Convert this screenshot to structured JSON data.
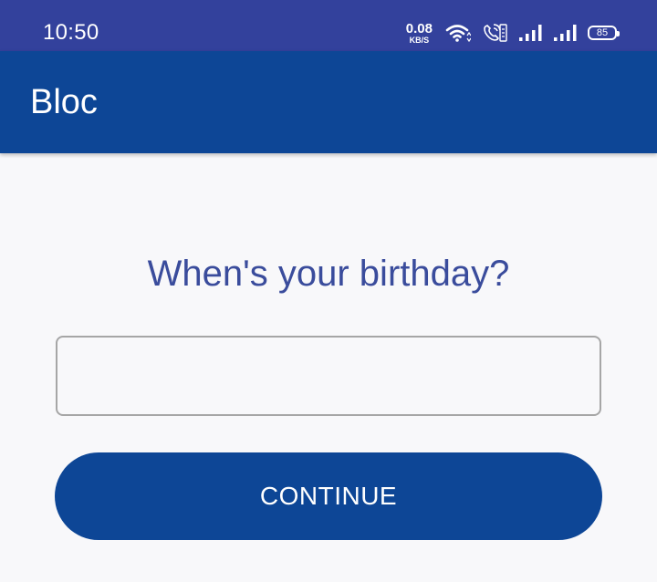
{
  "status_bar": {
    "time": "10:50",
    "net_speed_value": "0.08",
    "net_speed_unit": "KB/S",
    "battery_level": "85",
    "icons": [
      "wifi-icon",
      "volte-call-icon",
      "signal-icon",
      "signal-icon"
    ]
  },
  "app_bar": {
    "title": "Bloc",
    "background_color": "#0d4696"
  },
  "form": {
    "question": "When's your birthday?",
    "input_value": "",
    "input_placeholder": "",
    "continue_label": "CONTINUE"
  },
  "colors": {
    "status_bar": "#33419c",
    "primary": "#0d4696",
    "question_text": "#3a4c9c",
    "background": "#f8f8fa"
  }
}
